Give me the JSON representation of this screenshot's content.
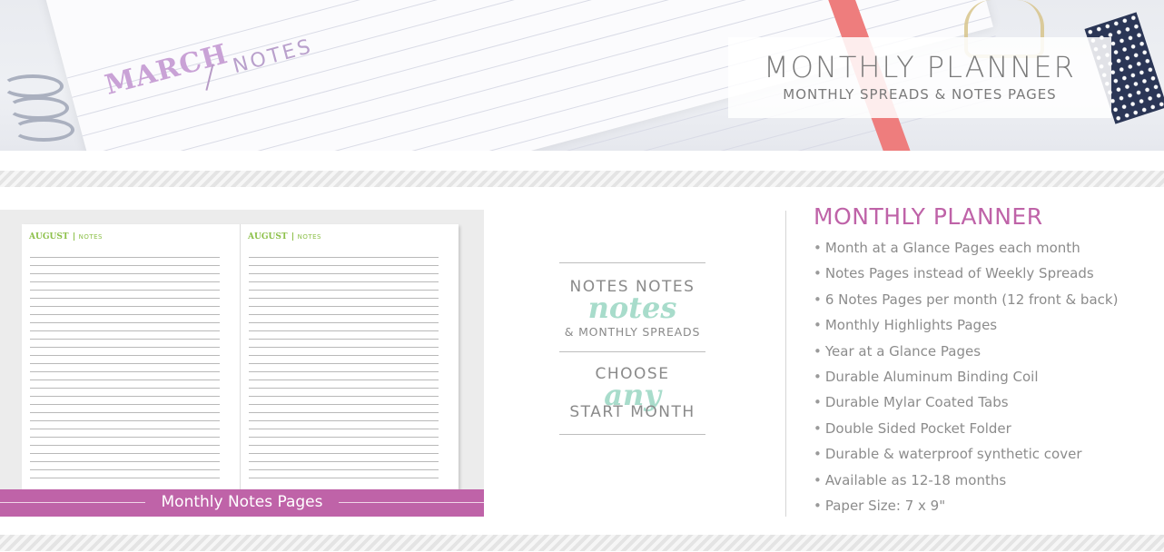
{
  "hero": {
    "planner_month": "MARCH",
    "planner_section": "NOTES",
    "title": "MONTHLY PLANNER",
    "subtitle": "MONTHLY SPREADS & NOTES PAGES"
  },
  "preview": {
    "pages": [
      {
        "month": "AUGUST",
        "section": "NOTES"
      },
      {
        "month": "AUGUST",
        "section": "NOTES"
      }
    ],
    "caption": "Monthly Notes Pages"
  },
  "badge": {
    "line1": "NOTES NOTES",
    "line1_script": "notes",
    "line1_sub": "& MONTHLY SPREADS",
    "line2": "CHOOSE",
    "line2_script": "any",
    "line2_sub": "START MONTH"
  },
  "features": {
    "heading": "MONTHLY PLANNER",
    "items": [
      "Month at a Glance Pages each month",
      "Notes Pages instead of Weekly Spreads",
      "6 Notes Pages per month (12 front & back)",
      "Monthly Highlights Pages",
      "Year at a Glance Pages",
      "Durable Aluminum Binding Coil",
      "Durable Mylar Coated Tabs",
      "Double Sided Pocket Folder",
      "Durable & waterproof synthetic cover",
      "Available as 12-18 months",
      "Paper Size: 7 x 9\""
    ]
  },
  "colors": {
    "accent": "#bf63a8",
    "mint": "#a8dccb",
    "green": "#8dc04a",
    "text_gray": "#8c8c8c"
  }
}
